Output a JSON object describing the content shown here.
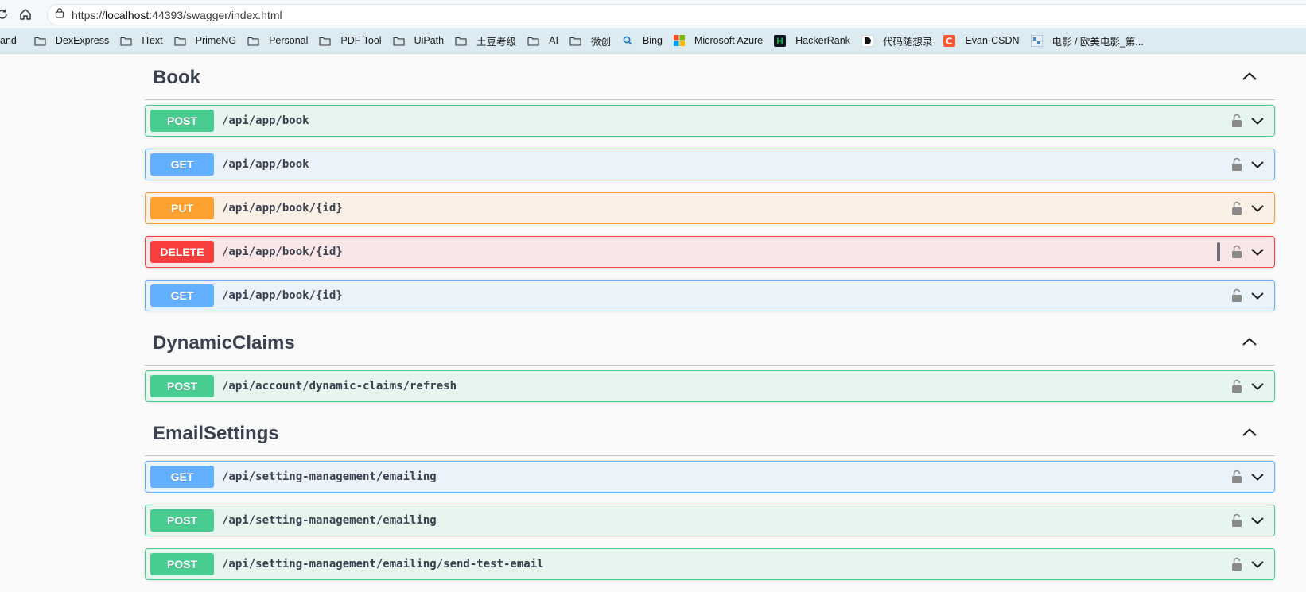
{
  "browser": {
    "url_prefix": "https://",
    "url_host": "localhost",
    "url_rest": ":44393/swagger/index.html"
  },
  "bookmarks": [
    {
      "label": "and",
      "icon": "folder-icon"
    },
    {
      "label": "DexExpress",
      "icon": "folder-icon"
    },
    {
      "label": "IText",
      "icon": "folder-icon"
    },
    {
      "label": "PrimeNG",
      "icon": "folder-icon"
    },
    {
      "label": "Personal",
      "icon": "folder-icon"
    },
    {
      "label": "PDF Tool",
      "icon": "folder-icon"
    },
    {
      "label": "UiPath",
      "icon": "folder-icon"
    },
    {
      "label": "土豆考级",
      "icon": "folder-icon"
    },
    {
      "label": "AI",
      "icon": "folder-icon"
    },
    {
      "label": "微创",
      "icon": "folder-icon"
    },
    {
      "label": "Bing",
      "icon": "bing-search-icon"
    },
    {
      "label": "Microsoft Azure",
      "icon": "microsoft-logo-icon"
    },
    {
      "label": "HackerRank",
      "icon": "hackerrank-logo-icon"
    },
    {
      "label": "代码随想录",
      "icon": "dmsxl-logo-icon"
    },
    {
      "label": "Evan-CSDN",
      "icon": "csdn-logo-icon"
    },
    {
      "label": "电影 / 欧美电影_第...",
      "icon": "movie-site-icon"
    }
  ],
  "colors": {
    "post": "#49cc90",
    "get": "#61affe",
    "put": "#fca130",
    "delete": "#f93e3e"
  },
  "sections": [
    {
      "title": "Book",
      "operations": [
        {
          "method": "POST",
          "path": "/api/app/book"
        },
        {
          "method": "GET",
          "path": "/api/app/book"
        },
        {
          "method": "PUT",
          "path": "/api/app/book/{id}"
        },
        {
          "method": "DELETE",
          "path": "/api/app/book/{id}"
        },
        {
          "method": "GET",
          "path": "/api/app/book/{id}"
        }
      ]
    },
    {
      "title": "DynamicClaims",
      "operations": [
        {
          "method": "POST",
          "path": "/api/account/dynamic-claims/refresh"
        }
      ]
    },
    {
      "title": "EmailSettings",
      "operations": [
        {
          "method": "GET",
          "path": "/api/setting-management/emailing"
        },
        {
          "method": "POST",
          "path": "/api/setting-management/emailing"
        },
        {
          "method": "POST",
          "path": "/api/setting-management/emailing/send-test-email"
        }
      ]
    }
  ]
}
